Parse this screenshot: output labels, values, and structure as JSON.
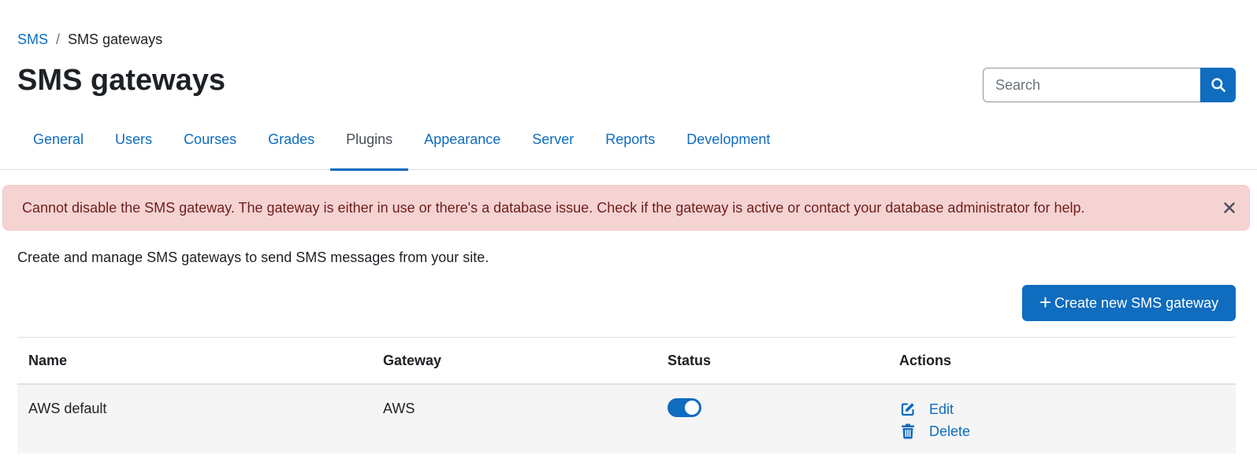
{
  "breadcrumb": {
    "parent": "SMS",
    "separator": "/",
    "current": "SMS gateways"
  },
  "page_title": "SMS gateways",
  "search": {
    "placeholder": "Search",
    "value": ""
  },
  "nav": {
    "tabs": [
      {
        "label": "General",
        "active": false
      },
      {
        "label": "Users",
        "active": false
      },
      {
        "label": "Courses",
        "active": false
      },
      {
        "label": "Grades",
        "active": false
      },
      {
        "label": "Plugins",
        "active": true
      },
      {
        "label": "Appearance",
        "active": false
      },
      {
        "label": "Server",
        "active": false
      },
      {
        "label": "Reports",
        "active": false
      },
      {
        "label": "Development",
        "active": false
      }
    ]
  },
  "alert": {
    "message": "Cannot disable the SMS gateway. The gateway is either in use or there's a database issue. Check if the gateway is active or contact your database administrator for help.",
    "close_icon": "close-icon"
  },
  "intro": "Create and manage SMS gateways to send SMS messages from your site.",
  "create_button": {
    "icon": "plus-icon",
    "label": "Create new SMS gateway"
  },
  "table": {
    "headers": {
      "name": "Name",
      "gateway": "Gateway",
      "status": "Status",
      "actions": "Actions"
    },
    "rows": [
      {
        "name": "AWS default",
        "gateway": "AWS",
        "status_enabled": true,
        "edit_label": "Edit",
        "delete_label": "Delete"
      }
    ]
  },
  "colors": {
    "accent": "#0f6cbf",
    "alert_bg": "#f6d3d3",
    "alert_text": "#6e1d1d",
    "row_bg": "#f5f5f5"
  }
}
